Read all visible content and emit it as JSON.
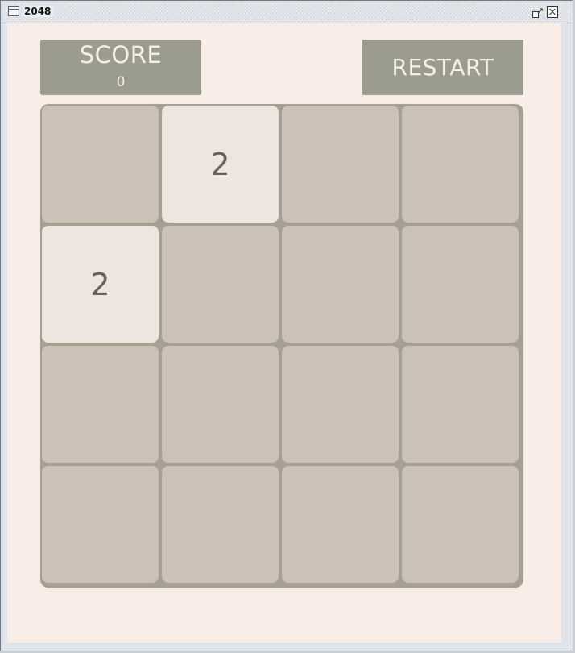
{
  "window": {
    "title": "2048"
  },
  "header": {
    "score_label": "SCORE",
    "score_value": "0",
    "restart_label": "RESTART"
  },
  "board": {
    "rows": [
      [
        "",
        "2",
        "",
        ""
      ],
      [
        "2",
        "",
        "",
        ""
      ],
      [
        "",
        "",
        "",
        ""
      ],
      [
        "",
        "",
        "",
        ""
      ]
    ]
  },
  "colors": {
    "page_background": "#f7ede6",
    "panel_background": "#9c9b90",
    "board_background": "#a69f94",
    "empty_cell": "#cbc1b6",
    "tile_2": "#ede6e0",
    "tile_text": "#6b6158"
  },
  "icons": [
    "app-window-icon",
    "restore-icon",
    "close-icon"
  ]
}
